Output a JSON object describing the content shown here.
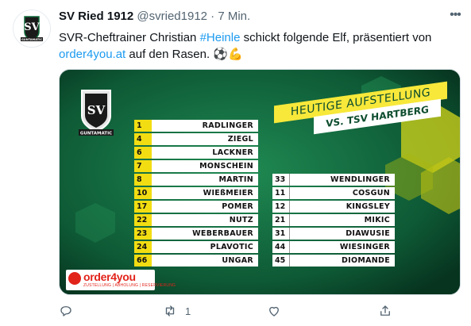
{
  "tweet": {
    "display_name": "SV Ried 1912",
    "handle": "@svried1912",
    "separator": "·",
    "time": "7 Min.",
    "more_label": "•••",
    "text_parts": {
      "p1": "SVR-Cheftrainer Christian ",
      "hashtag": "#Heinle",
      "p2": " schickt folgende Elf, präsentiert von",
      "link": "order4you.at",
      "p3": " auf den Rasen. ⚽💪"
    }
  },
  "media": {
    "club_label": "GUNTAMATIC",
    "banner_title": "HEUTIGE AUFSTELLUNG",
    "banner_opponent": "VS. TSV HARTBERG",
    "starting": [
      {
        "num": "1",
        "name": "RADLINGER"
      },
      {
        "num": "4",
        "name": "ZIEGL"
      },
      {
        "num": "6",
        "name": "LACKNER"
      },
      {
        "num": "7",
        "name": "MONSCHEIN"
      },
      {
        "num": "8",
        "name": "MARTIN"
      },
      {
        "num": "10",
        "name": "WIEßMEIER"
      },
      {
        "num": "17",
        "name": "POMER"
      },
      {
        "num": "22",
        "name": "NUTZ"
      },
      {
        "num": "23",
        "name": "WEBERBAUER"
      },
      {
        "num": "24",
        "name": "PLAVOTIC"
      },
      {
        "num": "66",
        "name": "UNGAR"
      }
    ],
    "substitutes": [
      {
        "num": "33",
        "name": "WENDLINGER"
      },
      {
        "num": "11",
        "name": "COSGUN"
      },
      {
        "num": "12",
        "name": "KINGSLEY"
      },
      {
        "num": "21",
        "name": "MIKIC"
      },
      {
        "num": "31",
        "name": "DIAWUSIE"
      },
      {
        "num": "44",
        "name": "WIESINGER"
      },
      {
        "num": "45",
        "name": "DIOMANDE"
      }
    ],
    "sponsor_brand": "order4you",
    "sponsor_tagline": "ZUSTELLUNG | ABHOLUNG | RESERVIERUNG"
  },
  "actions": {
    "reply_count": "",
    "retweet_count": "1",
    "like_count": ""
  },
  "colors": {
    "accent_link": "#1d9bf0",
    "pitch_green": "#0d5233",
    "banner_yellow": "#f7e83a",
    "number_yellow": "#f2dd12",
    "sponsor_red": "#e2231a"
  }
}
